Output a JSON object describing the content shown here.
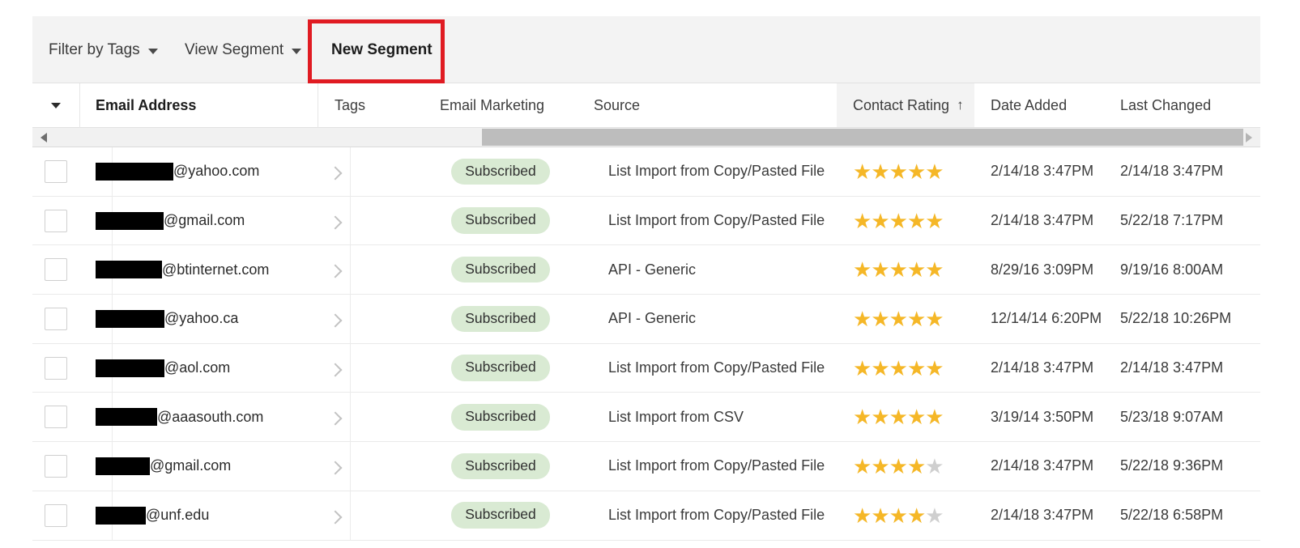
{
  "toolbar": {
    "filter_by_tags": "Filter by Tags",
    "view_segment": "View Segment",
    "new_segment": "New Segment",
    "highlight_color": "#e01b22"
  },
  "table": {
    "headers": {
      "select_all": "",
      "email_address": "Email Address",
      "tags": "Tags",
      "email_marketing": "Email Marketing",
      "source": "Source",
      "contact_rating": "Contact Rating",
      "sort_indicator": "↑",
      "date_added": "Date Added",
      "last_changed": "Last Changed"
    },
    "sorted_column": "Contact Rating",
    "sort_direction": "ascending",
    "badge_color": "#d9ead3",
    "star_color": "#f5b727",
    "star_empty_color": "#cfcfcf",
    "rows": [
      {
        "redact_width": 96,
        "email_domain": "@yahoo.com",
        "tags": "",
        "email_marketing": "Subscribed",
        "source": "List Import from Copy/Pasted File",
        "rating": 5,
        "date_added": "2/14/18 3:47PM",
        "last_changed": "2/14/18 3:47PM"
      },
      {
        "redact_width": 84,
        "email_domain": "@gmail.com",
        "tags": "",
        "email_marketing": "Subscribed",
        "source": "List Import from Copy/Pasted File",
        "rating": 5,
        "date_added": "2/14/18 3:47PM",
        "last_changed": "5/22/18 7:17PM"
      },
      {
        "redact_width": 82,
        "email_domain": "@btinternet.com",
        "tags": "",
        "email_marketing": "Subscribed",
        "source": "API - Generic",
        "rating": 5,
        "date_added": "8/29/16 3:09PM",
        "last_changed": "9/19/16 8:00AM"
      },
      {
        "redact_width": 85,
        "email_domain": "@yahoo.ca",
        "tags": "",
        "email_marketing": "Subscribed",
        "source": "API - Generic",
        "rating": 5,
        "date_added": "12/14/14 6:20PM",
        "last_changed": "5/22/18 10:26PM"
      },
      {
        "redact_width": 85,
        "email_domain": "@aol.com",
        "tags": "",
        "email_marketing": "Subscribed",
        "source": "List Import from Copy/Pasted File",
        "rating": 5,
        "date_added": "2/14/18 3:47PM",
        "last_changed": "2/14/18 3:47PM"
      },
      {
        "redact_width": 76,
        "email_domain": "@aaasouth.com",
        "tags": "",
        "email_marketing": "Subscribed",
        "source": "List Import from CSV",
        "rating": 5,
        "date_added": "3/19/14 3:50PM",
        "last_changed": "5/23/18 9:07AM"
      },
      {
        "redact_width": 67,
        "email_domain": "@gmail.com",
        "tags": "",
        "email_marketing": "Subscribed",
        "source": "List Import from Copy/Pasted File",
        "rating": 4,
        "date_added": "2/14/18 3:47PM",
        "last_changed": "5/22/18 9:36PM"
      },
      {
        "redact_width": 62,
        "email_domain": "@unf.edu",
        "tags": "",
        "email_marketing": "Subscribed",
        "source": "List Import from Copy/Pasted File",
        "rating": 4,
        "date_added": "2/14/18 3:47PM",
        "last_changed": "5/22/18 6:58PM"
      }
    ]
  },
  "scrollbar": {
    "left_arrow": "◀",
    "right_arrow": "▶",
    "thumb_position_pct": 37
  }
}
